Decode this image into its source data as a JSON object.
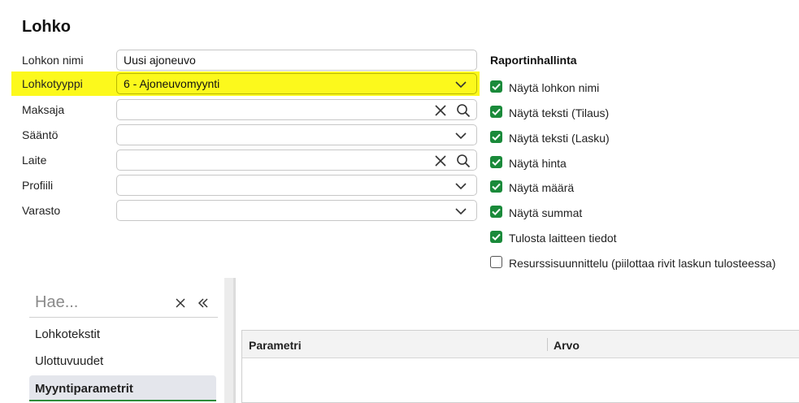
{
  "page": {
    "title": "Lohko"
  },
  "form": {
    "fields": [
      {
        "label": "Lohkon nimi",
        "value": "Uusi ajoneuvo",
        "kind": "text"
      },
      {
        "label": "Lohkotyyppi",
        "value": "6 - Ajoneuvomyynti",
        "kind": "select",
        "highlighted": true,
        "highlight_color": "#fcf91c"
      },
      {
        "label": "Maksaja",
        "value": "",
        "kind": "lookup"
      },
      {
        "label": "Sääntö",
        "value": "",
        "kind": "select"
      },
      {
        "label": "Laite",
        "value": "",
        "kind": "lookup"
      },
      {
        "label": "Profiili",
        "value": "",
        "kind": "select"
      },
      {
        "label": "Varasto",
        "value": "",
        "kind": "select"
      }
    ]
  },
  "report": {
    "title": "Raportinhallinta",
    "options": [
      {
        "label": "Näytä lohkon nimi",
        "checked": true
      },
      {
        "label": "Näytä teksti (Tilaus)",
        "checked": true
      },
      {
        "label": "Näytä teksti (Lasku)",
        "checked": true
      },
      {
        "label": "Näytä hinta",
        "checked": true
      },
      {
        "label": "Näytä määrä",
        "checked": true
      },
      {
        "label": "Näytä summat",
        "checked": true
      },
      {
        "label": "Tulosta laitteen tiedot",
        "checked": true
      },
      {
        "label": "Resurssisuunnittelu (piilottaa rivit laskun tulosteessa)",
        "checked": false
      }
    ],
    "checked_color": "#1a8a3a"
  },
  "sidenav": {
    "search_placeholder": "Hae...",
    "items": [
      {
        "label": "Lohkotekstit",
        "active": false
      },
      {
        "label": "Ulottuvuudet",
        "active": false
      },
      {
        "label": "Myyntiparametrit",
        "active": true
      }
    ]
  },
  "grid": {
    "columns": [
      "Parametri",
      "Arvo"
    ]
  },
  "icons": {
    "clear": "close-icon",
    "search": "search-icon",
    "dropdown": "chevron-down-icon",
    "collapse": "double-chevron-left-icon"
  }
}
